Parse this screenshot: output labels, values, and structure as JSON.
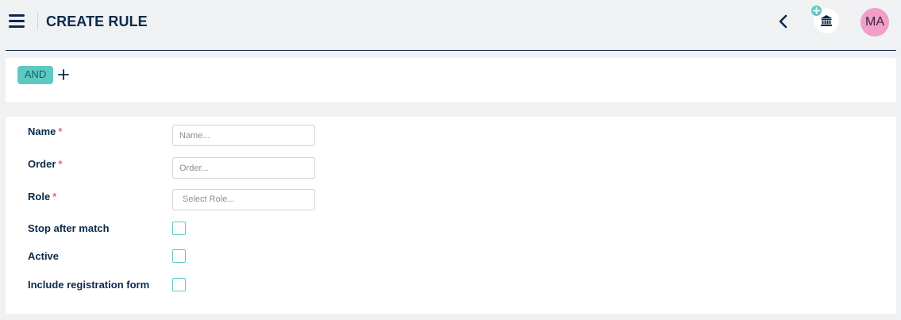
{
  "header": {
    "title": "CREATE RULE",
    "menu_icon": "hamburger-menu-icon",
    "back_icon": "chevron-left-icon",
    "bank_icon": "bank-icon",
    "avatar_initials": "MA",
    "avatar_color": "#f19ec9",
    "accent_color": "#5ec9c4"
  },
  "logic": {
    "operator_label": "AND",
    "add_icon": "plus-icon"
  },
  "form": {
    "name": {
      "label": "Name",
      "required_mark": "*",
      "placeholder": "Name...",
      "value": ""
    },
    "order": {
      "label": "Order",
      "required_mark": "*",
      "placeholder": "Order...",
      "value": ""
    },
    "role": {
      "label": "Role",
      "required_mark": "*",
      "placeholder": "Select Role..."
    },
    "stop_after_match": {
      "label": "Stop after match",
      "checked": false
    },
    "active": {
      "label": "Active",
      "checked": false
    },
    "include_registration_form": {
      "label": "Include registration form",
      "checked": false
    }
  }
}
